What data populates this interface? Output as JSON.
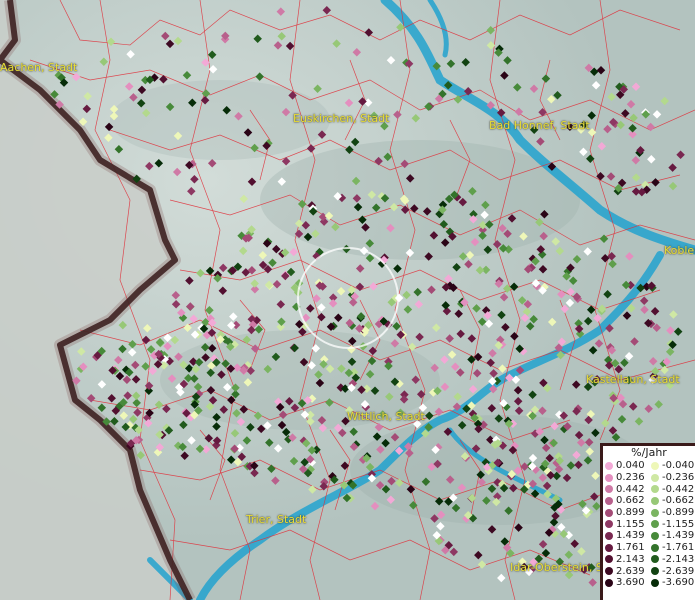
{
  "map": {
    "places": [
      {
        "id": "aachen",
        "label": "Aachen, Stadt"
      },
      {
        "id": "euskirchen",
        "label": "Euskirchen, Stadt"
      },
      {
        "id": "badhonnef",
        "label": "Bad Honnef, Stadt"
      },
      {
        "id": "koblenz",
        "label": "Koblen"
      },
      {
        "id": "kastellaun",
        "label": "Kastellaun, Stadt"
      },
      {
        "id": "wittlich",
        "label": "Wittlich, Stadt"
      },
      {
        "id": "trier",
        "label": "Trier, Stadt"
      },
      {
        "id": "idaroberstein",
        "label": "Idar-Oberstein, St"
      }
    ],
    "colors": {
      "terrain": "#b9c7c3",
      "boundaries": "#e0303a",
      "border": "#2a1414",
      "water": "#23a3cf",
      "highlight_circle": "#ffffff"
    }
  },
  "legend": {
    "title": "%/Jahr",
    "positive": [
      {
        "value": "0.040",
        "color": "#f2a9d6"
      },
      {
        "value": "0.236",
        "color": "#e48fbf"
      },
      {
        "value": "0.442",
        "color": "#cf7aa6"
      },
      {
        "value": "0.662",
        "color": "#b8608c"
      },
      {
        "value": "0.899",
        "color": "#a44b76"
      },
      {
        "value": "1.155",
        "color": "#8e3863"
      },
      {
        "value": "1.439",
        "color": "#7a2851"
      },
      {
        "value": "1.761",
        "color": "#661a40"
      },
      {
        "value": "2.143",
        "color": "#521030"
      },
      {
        "value": "2.639",
        "color": "#3d0922"
      },
      {
        "value": "3.690",
        "color": "#2a0416"
      }
    ],
    "negative": [
      {
        "value": "-0.040",
        "color": "#eef7b8"
      },
      {
        "value": "-0.236",
        "color": "#cfe8a4"
      },
      {
        "value": "-0.442",
        "color": "#b3d98d"
      },
      {
        "value": "-0.662",
        "color": "#97c877"
      },
      {
        "value": "-0.899",
        "color": "#7bb562"
      },
      {
        "value": "-1.155",
        "color": "#5f9f4c"
      },
      {
        "value": "-1.439",
        "color": "#478a3a"
      },
      {
        "value": "-1.761",
        "color": "#33732b"
      },
      {
        "value": "-2.143",
        "color": "#215b1d"
      },
      {
        "value": "-2.639",
        "color": "#124312"
      },
      {
        "value": "-3.690",
        "color": "#062c08"
      }
    ]
  }
}
